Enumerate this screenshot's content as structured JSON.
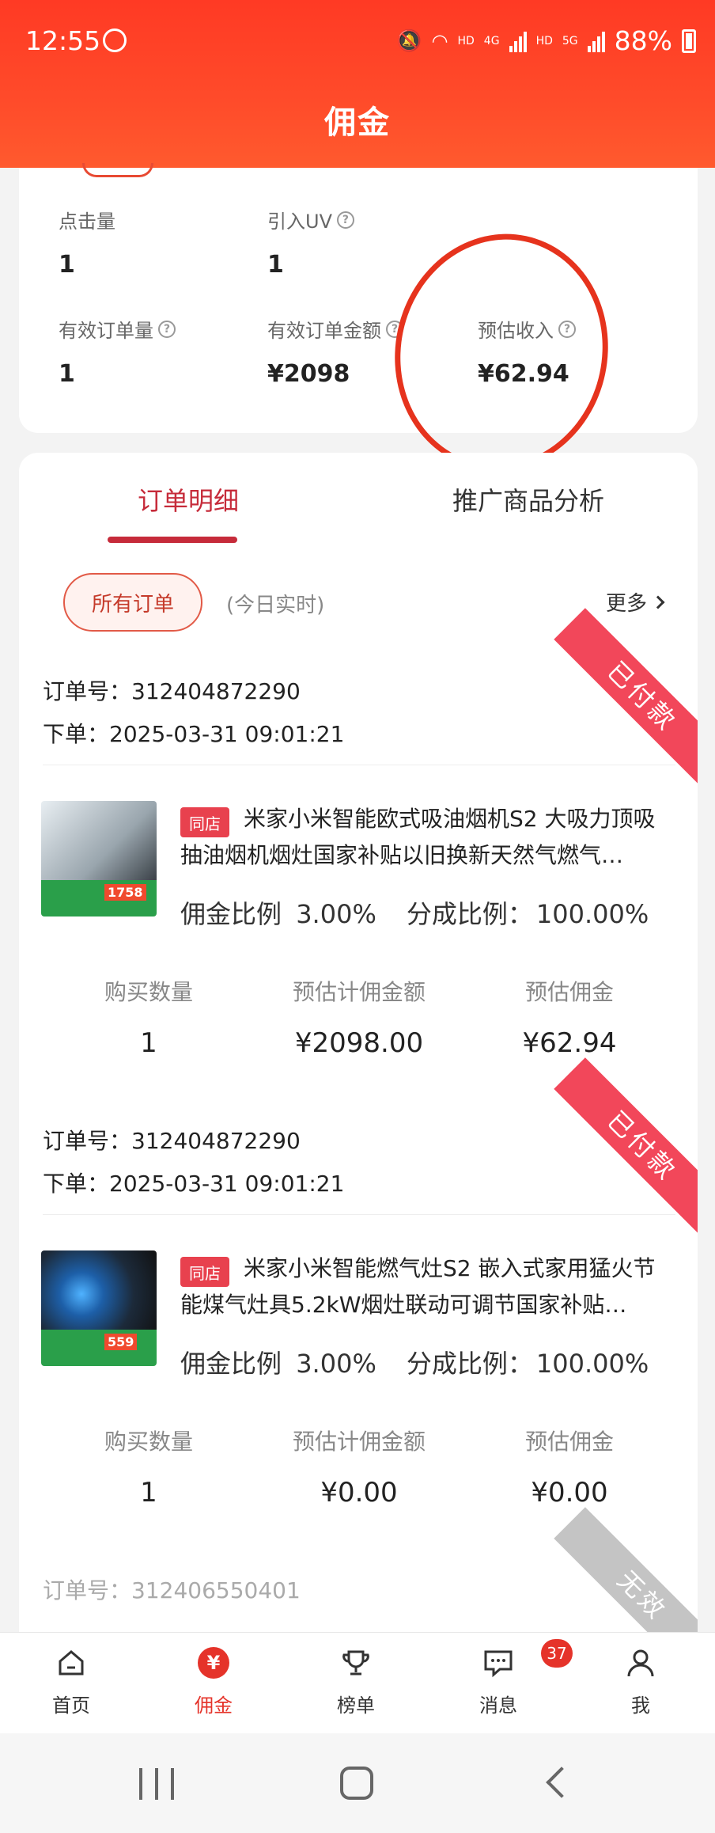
{
  "status_bar": {
    "time": "12:55",
    "battery": "88%",
    "net1": "HD",
    "net2": "4G",
    "net3": "HD",
    "net4": "5G"
  },
  "header": {
    "title": "佣金"
  },
  "stats": {
    "clicks": {
      "label": "点击量",
      "value": "1"
    },
    "uv": {
      "label": "引入UV",
      "value": "1"
    },
    "valid_orders": {
      "label": "有效订单量",
      "value": "1"
    },
    "valid_amount": {
      "label": "有效订单金额",
      "value": "¥2098"
    },
    "est_income": {
      "label": "预估收入",
      "value": "¥62.94"
    },
    "help_glyph": "?"
  },
  "tabs": {
    "active": "订单明细",
    "inactive": "推广商品分析"
  },
  "filter": {
    "chip": "所有订单",
    "note": "(今日实时)",
    "more": "更多"
  },
  "labels": {
    "order_no": "订单号：",
    "placed": "下单：",
    "shop_tag": "同店",
    "commission_rate": "佣金比例",
    "share_rate": "分成比例：",
    "qty": "购买数量",
    "est_base": "预估计佣金额",
    "est_commission": "预估佣金"
  },
  "orders": [
    {
      "status": "已付款",
      "order_no": "312404872290",
      "time": "2025-03-31 09:01:21",
      "title": "米家小米智能欧式吸油烟机S2 大吸力顶吸抽油烟机烟灶国家补贴以旧换新天然气燃气…",
      "commission_rate": "3.00%",
      "share_rate": "100.00%",
      "qty": "1",
      "est_base": "¥2098.00",
      "est_commission": "¥62.94",
      "thumb_price": "1758"
    },
    {
      "status": "已付款",
      "order_no": "312404872290",
      "time": "2025-03-31 09:01:21",
      "title": "米家小米智能燃气灶S2 嵌入式家用猛火节能煤气灶具5.2kW烟灶联动可调节国家补贴…",
      "commission_rate": "3.00%",
      "share_rate": "100.00%",
      "qty": "1",
      "est_base": "¥0.00",
      "est_commission": "¥0.00",
      "thumb_price": "559"
    },
    {
      "status": "无效",
      "order_no": "312406550401"
    }
  ],
  "bottom_nav": [
    {
      "label": "首页",
      "icon": "home-icon"
    },
    {
      "label": "佣金",
      "icon": "yen-icon",
      "glyph": "¥"
    },
    {
      "label": "榜单",
      "icon": "trophy-icon"
    },
    {
      "label": "消息",
      "icon": "message-icon",
      "badge": "37"
    },
    {
      "label": "我",
      "icon": "person-icon"
    }
  ],
  "colors": {
    "header": "#ff4b2a",
    "accent": "#c62b3a",
    "paid_ribbon": "#f2475a",
    "invalid_ribbon": "#c4c4c4",
    "annotation": "#e6331d"
  }
}
